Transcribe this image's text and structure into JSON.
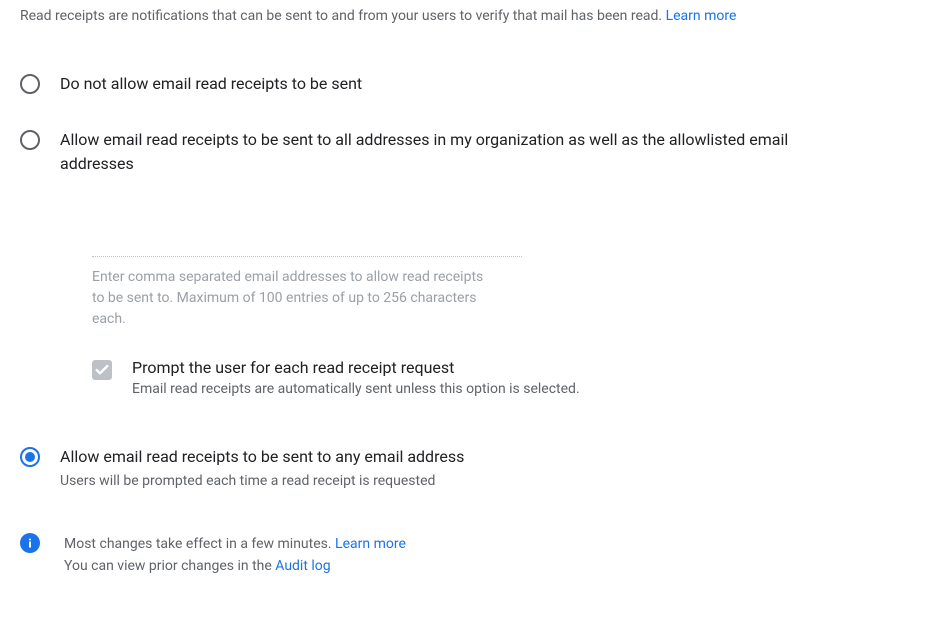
{
  "intro": {
    "text": "Read receipts are notifications that can be sent to and from your users to verify that mail has been read. ",
    "learn_more": "Learn more"
  },
  "options": {
    "opt1": {
      "label": "Do not allow email read receipts to be sent"
    },
    "opt2": {
      "label": "Allow email read receipts to be sent to all addresses in my organization as well as the allowlisted email addresses",
      "input_value": "",
      "input_helper": "Enter comma separated email addresses to allow read receipts to be sent to. Maximum of 100 entries of up to 256 characters each.",
      "checkbox": {
        "label": "Prompt the user for each read receipt request",
        "sublabel": "Email read receipts are automatically sent unless this option is selected."
      }
    },
    "opt3": {
      "label": "Allow email read receipts to be sent to any email address",
      "sublabel": "Users will be prompted each time a read receipt is requested"
    }
  },
  "footer": {
    "line1_pre": "Most changes take effect in a few minutes. ",
    "line1_link": "Learn more",
    "line2_pre": "You can view prior changes in the ",
    "line2_link": "Audit log"
  }
}
